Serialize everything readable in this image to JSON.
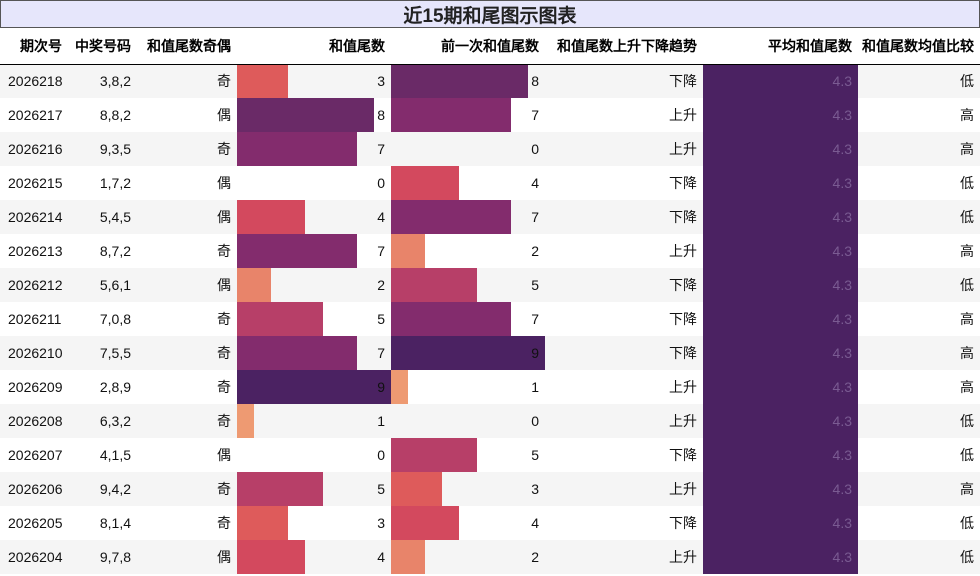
{
  "title": "近15期和尾图示图表",
  "columns": {
    "period": "期次号",
    "numbers": "中奖号码",
    "parity": "和值尾数奇偶",
    "tail": "和值尾数",
    "prev_tail": "前一次和值尾数",
    "trend": "和值尾数上升下降趋势",
    "avg": "平均和值尾数",
    "compare": "和值尾数均值比较"
  },
  "scale_max": 9,
  "colors": {
    "0": "#ffffff",
    "1": "#ee9a72",
    "2": "#e8846a",
    "3": "#de5b5b",
    "4": "#d3495e",
    "5": "#b73f68",
    "7": "#832c6d",
    "8": "#6a2a67",
    "9": "#4b2262",
    "avg": "#4b2262"
  },
  "rows": [
    {
      "period": "2026218",
      "numbers": "3,8,2",
      "parity": "奇",
      "tail": 3,
      "prev_tail": 8,
      "trend": "下降",
      "avg": "4.3",
      "compare": "低"
    },
    {
      "period": "2026217",
      "numbers": "8,8,2",
      "parity": "偶",
      "tail": 8,
      "prev_tail": 7,
      "trend": "上升",
      "avg": "4.3",
      "compare": "高"
    },
    {
      "period": "2026216",
      "numbers": "9,3,5",
      "parity": "奇",
      "tail": 7,
      "prev_tail": 0,
      "trend": "上升",
      "avg": "4.3",
      "compare": "高"
    },
    {
      "period": "2026215",
      "numbers": "1,7,2",
      "parity": "偶",
      "tail": 0,
      "prev_tail": 4,
      "trend": "下降",
      "avg": "4.3",
      "compare": "低"
    },
    {
      "period": "2026214",
      "numbers": "5,4,5",
      "parity": "偶",
      "tail": 4,
      "prev_tail": 7,
      "trend": "下降",
      "avg": "4.3",
      "compare": "低"
    },
    {
      "period": "2026213",
      "numbers": "8,7,2",
      "parity": "奇",
      "tail": 7,
      "prev_tail": 2,
      "trend": "上升",
      "avg": "4.3",
      "compare": "高"
    },
    {
      "period": "2026212",
      "numbers": "5,6,1",
      "parity": "偶",
      "tail": 2,
      "prev_tail": 5,
      "trend": "下降",
      "avg": "4.3",
      "compare": "低"
    },
    {
      "period": "2026211",
      "numbers": "7,0,8",
      "parity": "奇",
      "tail": 5,
      "prev_tail": 7,
      "trend": "下降",
      "avg": "4.3",
      "compare": "高"
    },
    {
      "period": "2026210",
      "numbers": "7,5,5",
      "parity": "奇",
      "tail": 7,
      "prev_tail": 9,
      "trend": "下降",
      "avg": "4.3",
      "compare": "高"
    },
    {
      "period": "2026209",
      "numbers": "2,8,9",
      "parity": "奇",
      "tail": 9,
      "prev_tail": 1,
      "trend": "上升",
      "avg": "4.3",
      "compare": "高"
    },
    {
      "period": "2026208",
      "numbers": "6,3,2",
      "parity": "奇",
      "tail": 1,
      "prev_tail": 0,
      "trend": "上升",
      "avg": "4.3",
      "compare": "低"
    },
    {
      "period": "2026207",
      "numbers": "4,1,5",
      "parity": "偶",
      "tail": 0,
      "prev_tail": 5,
      "trend": "下降",
      "avg": "4.3",
      "compare": "低"
    },
    {
      "period": "2026206",
      "numbers": "9,4,2",
      "parity": "奇",
      "tail": 5,
      "prev_tail": 3,
      "trend": "上升",
      "avg": "4.3",
      "compare": "高"
    },
    {
      "period": "2026205",
      "numbers": "8,1,4",
      "parity": "奇",
      "tail": 3,
      "prev_tail": 4,
      "trend": "下降",
      "avg": "4.3",
      "compare": "低"
    },
    {
      "period": "2026204",
      "numbers": "9,7,8",
      "parity": "偶",
      "tail": 4,
      "prev_tail": 2,
      "trend": "上升",
      "avg": "4.3",
      "compare": "低"
    }
  ]
}
